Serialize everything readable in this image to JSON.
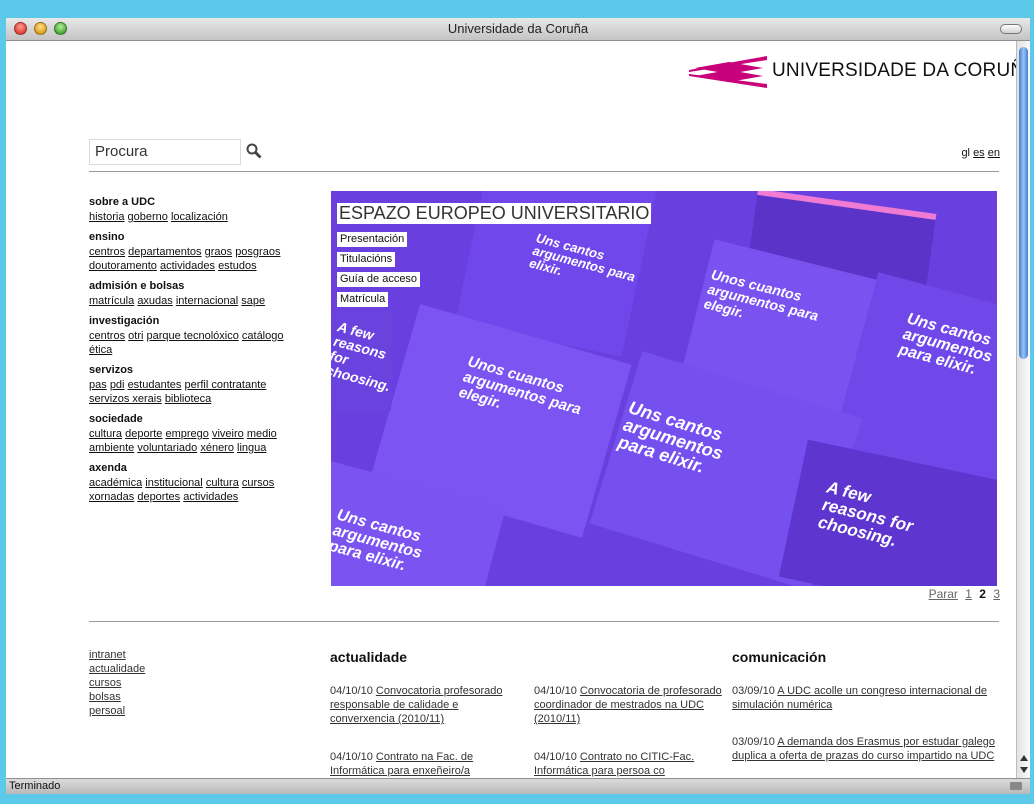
{
  "window": {
    "title": "Universidade da Coruña",
    "status": "Terminado"
  },
  "logo": {
    "text": "UNIVERSIDADE DA CORUÑA"
  },
  "search": {
    "placeholder": "Procura"
  },
  "languages": [
    "gl",
    "es",
    "en"
  ],
  "menu": [
    {
      "title": "sobre a UDC",
      "links": [
        "historia",
        "goberno",
        "localización"
      ]
    },
    {
      "title": "ensino",
      "links": [
        "centros",
        "departamentos",
        "graos",
        "posgraos",
        "doutoramento",
        "actividades",
        "estudos"
      ]
    },
    {
      "title": "admisión e bolsas",
      "links": [
        "matrícula",
        "axudas",
        "internacional",
        "sape"
      ]
    },
    {
      "title": "investigación",
      "links": [
        "centros",
        "otri",
        "parque tecnolóxico",
        "catálogo",
        "ética"
      ]
    },
    {
      "title": "servizos",
      "links": [
        "pas",
        "pdi",
        "estudantes",
        "perfil contratante",
        "servizos xerais",
        "biblioteca"
      ]
    },
    {
      "title": "sociedade",
      "links": [
        "cultura",
        "deporte",
        "emprego",
        "viveiro",
        "medio ambiente",
        "voluntariado",
        "xénero",
        "lingua"
      ]
    },
    {
      "title": "axenda",
      "links": [
        "académica",
        "institucional",
        "cultura",
        "cursos",
        "xornadas",
        "deportes",
        "actividades"
      ]
    }
  ],
  "hero": {
    "title": "ESPAZO EUROPEO UNIVERSITARIO",
    "links": [
      "Presentación",
      "Titulacións",
      "Guía de acceso",
      "Matrícula"
    ],
    "image_texts": {
      "a": "Unos cuantos argumentos para elegir.",
      "b": "Uns cantos argumentos para elixir.",
      "c": "A few reasons for choosing."
    }
  },
  "pager": {
    "stop": "Parar",
    "pages": [
      "1",
      "2",
      "3"
    ],
    "current": "2"
  },
  "footer_links": [
    "intranet",
    "actualidade",
    "cursos",
    "bolsas",
    "persoal"
  ],
  "actualidade": {
    "title": "actualidade",
    "items": [
      {
        "date": "04/10/10",
        "text": "Convocatoria profesorado responsable de calidade e converxencia (2010/11)"
      },
      {
        "date": "04/10/10",
        "text": "Convocatoria de profesorado coordinador de mestrados na UDC (2010/11)"
      },
      {
        "date": "04/10/10",
        "text": "Contrato na Fac. de Informática para enxeñeiro/a"
      },
      {
        "date": "04/10/10",
        "text": "Contrato no CITIC-Fac. Informática para persoa co"
      }
    ]
  },
  "comunicacion": {
    "title": "comunicación",
    "items": [
      {
        "date": "03/09/10",
        "text": "A UDC acolle un congreso internacional de simulación numérica"
      },
      {
        "date": "03/09/10",
        "text": "A demanda dos Erasmus por estudar galego duplica a oferta de prazas do curso impartido na UDC"
      }
    ]
  },
  "colors": {
    "brand": "#c8007a",
    "hero_bg": "#6a3fe0",
    "window_border": "#5cc8ea"
  }
}
